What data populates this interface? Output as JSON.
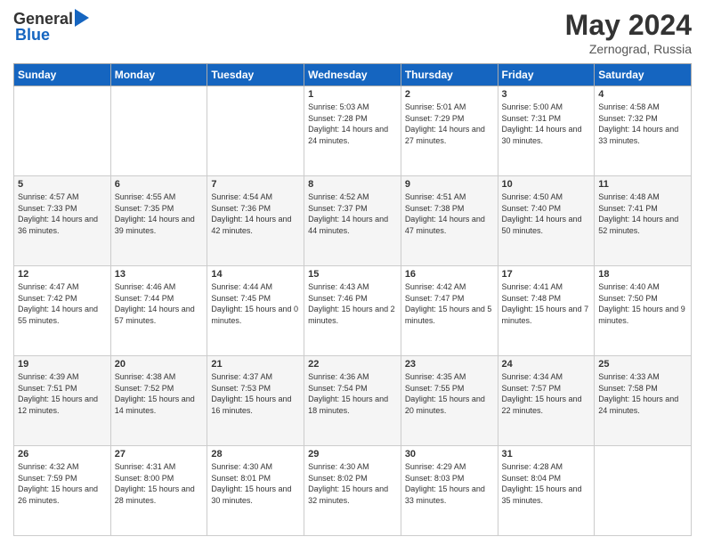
{
  "header": {
    "logo_general": "General",
    "logo_blue": "Blue",
    "title": "May 2024",
    "location": "Zernograd, Russia"
  },
  "calendar": {
    "days_of_week": [
      "Sunday",
      "Monday",
      "Tuesday",
      "Wednesday",
      "Thursday",
      "Friday",
      "Saturday"
    ],
    "weeks": [
      [
        {
          "day": "",
          "sunrise": "",
          "sunset": "",
          "daylight": ""
        },
        {
          "day": "",
          "sunrise": "",
          "sunset": "",
          "daylight": ""
        },
        {
          "day": "",
          "sunrise": "",
          "sunset": "",
          "daylight": ""
        },
        {
          "day": "1",
          "sunrise": "Sunrise: 5:03 AM",
          "sunset": "Sunset: 7:28 PM",
          "daylight": "Daylight: 14 hours and 24 minutes."
        },
        {
          "day": "2",
          "sunrise": "Sunrise: 5:01 AM",
          "sunset": "Sunset: 7:29 PM",
          "daylight": "Daylight: 14 hours and 27 minutes."
        },
        {
          "day": "3",
          "sunrise": "Sunrise: 5:00 AM",
          "sunset": "Sunset: 7:31 PM",
          "daylight": "Daylight: 14 hours and 30 minutes."
        },
        {
          "day": "4",
          "sunrise": "Sunrise: 4:58 AM",
          "sunset": "Sunset: 7:32 PM",
          "daylight": "Daylight: 14 hours and 33 minutes."
        }
      ],
      [
        {
          "day": "5",
          "sunrise": "Sunrise: 4:57 AM",
          "sunset": "Sunset: 7:33 PM",
          "daylight": "Daylight: 14 hours and 36 minutes."
        },
        {
          "day": "6",
          "sunrise": "Sunrise: 4:55 AM",
          "sunset": "Sunset: 7:35 PM",
          "daylight": "Daylight: 14 hours and 39 minutes."
        },
        {
          "day": "7",
          "sunrise": "Sunrise: 4:54 AM",
          "sunset": "Sunset: 7:36 PM",
          "daylight": "Daylight: 14 hours and 42 minutes."
        },
        {
          "day": "8",
          "sunrise": "Sunrise: 4:52 AM",
          "sunset": "Sunset: 7:37 PM",
          "daylight": "Daylight: 14 hours and 44 minutes."
        },
        {
          "day": "9",
          "sunrise": "Sunrise: 4:51 AM",
          "sunset": "Sunset: 7:38 PM",
          "daylight": "Daylight: 14 hours and 47 minutes."
        },
        {
          "day": "10",
          "sunrise": "Sunrise: 4:50 AM",
          "sunset": "Sunset: 7:40 PM",
          "daylight": "Daylight: 14 hours and 50 minutes."
        },
        {
          "day": "11",
          "sunrise": "Sunrise: 4:48 AM",
          "sunset": "Sunset: 7:41 PM",
          "daylight": "Daylight: 14 hours and 52 minutes."
        }
      ],
      [
        {
          "day": "12",
          "sunrise": "Sunrise: 4:47 AM",
          "sunset": "Sunset: 7:42 PM",
          "daylight": "Daylight: 14 hours and 55 minutes."
        },
        {
          "day": "13",
          "sunrise": "Sunrise: 4:46 AM",
          "sunset": "Sunset: 7:44 PM",
          "daylight": "Daylight: 14 hours and 57 minutes."
        },
        {
          "day": "14",
          "sunrise": "Sunrise: 4:44 AM",
          "sunset": "Sunset: 7:45 PM",
          "daylight": "Daylight: 15 hours and 0 minutes."
        },
        {
          "day": "15",
          "sunrise": "Sunrise: 4:43 AM",
          "sunset": "Sunset: 7:46 PM",
          "daylight": "Daylight: 15 hours and 2 minutes."
        },
        {
          "day": "16",
          "sunrise": "Sunrise: 4:42 AM",
          "sunset": "Sunset: 7:47 PM",
          "daylight": "Daylight: 15 hours and 5 minutes."
        },
        {
          "day": "17",
          "sunrise": "Sunrise: 4:41 AM",
          "sunset": "Sunset: 7:48 PM",
          "daylight": "Daylight: 15 hours and 7 minutes."
        },
        {
          "day": "18",
          "sunrise": "Sunrise: 4:40 AM",
          "sunset": "Sunset: 7:50 PM",
          "daylight": "Daylight: 15 hours and 9 minutes."
        }
      ],
      [
        {
          "day": "19",
          "sunrise": "Sunrise: 4:39 AM",
          "sunset": "Sunset: 7:51 PM",
          "daylight": "Daylight: 15 hours and 12 minutes."
        },
        {
          "day": "20",
          "sunrise": "Sunrise: 4:38 AM",
          "sunset": "Sunset: 7:52 PM",
          "daylight": "Daylight: 15 hours and 14 minutes."
        },
        {
          "day": "21",
          "sunrise": "Sunrise: 4:37 AM",
          "sunset": "Sunset: 7:53 PM",
          "daylight": "Daylight: 15 hours and 16 minutes."
        },
        {
          "day": "22",
          "sunrise": "Sunrise: 4:36 AM",
          "sunset": "Sunset: 7:54 PM",
          "daylight": "Daylight: 15 hours and 18 minutes."
        },
        {
          "day": "23",
          "sunrise": "Sunrise: 4:35 AM",
          "sunset": "Sunset: 7:55 PM",
          "daylight": "Daylight: 15 hours and 20 minutes."
        },
        {
          "day": "24",
          "sunrise": "Sunrise: 4:34 AM",
          "sunset": "Sunset: 7:57 PM",
          "daylight": "Daylight: 15 hours and 22 minutes."
        },
        {
          "day": "25",
          "sunrise": "Sunrise: 4:33 AM",
          "sunset": "Sunset: 7:58 PM",
          "daylight": "Daylight: 15 hours and 24 minutes."
        }
      ],
      [
        {
          "day": "26",
          "sunrise": "Sunrise: 4:32 AM",
          "sunset": "Sunset: 7:59 PM",
          "daylight": "Daylight: 15 hours and 26 minutes."
        },
        {
          "day": "27",
          "sunrise": "Sunrise: 4:31 AM",
          "sunset": "Sunset: 8:00 PM",
          "daylight": "Daylight: 15 hours and 28 minutes."
        },
        {
          "day": "28",
          "sunrise": "Sunrise: 4:30 AM",
          "sunset": "Sunset: 8:01 PM",
          "daylight": "Daylight: 15 hours and 30 minutes."
        },
        {
          "day": "29",
          "sunrise": "Sunrise: 4:30 AM",
          "sunset": "Sunset: 8:02 PM",
          "daylight": "Daylight: 15 hours and 32 minutes."
        },
        {
          "day": "30",
          "sunrise": "Sunrise: 4:29 AM",
          "sunset": "Sunset: 8:03 PM",
          "daylight": "Daylight: 15 hours and 33 minutes."
        },
        {
          "day": "31",
          "sunrise": "Sunrise: 4:28 AM",
          "sunset": "Sunset: 8:04 PM",
          "daylight": "Daylight: 15 hours and 35 minutes."
        },
        {
          "day": "",
          "sunrise": "",
          "sunset": "",
          "daylight": ""
        }
      ]
    ]
  }
}
